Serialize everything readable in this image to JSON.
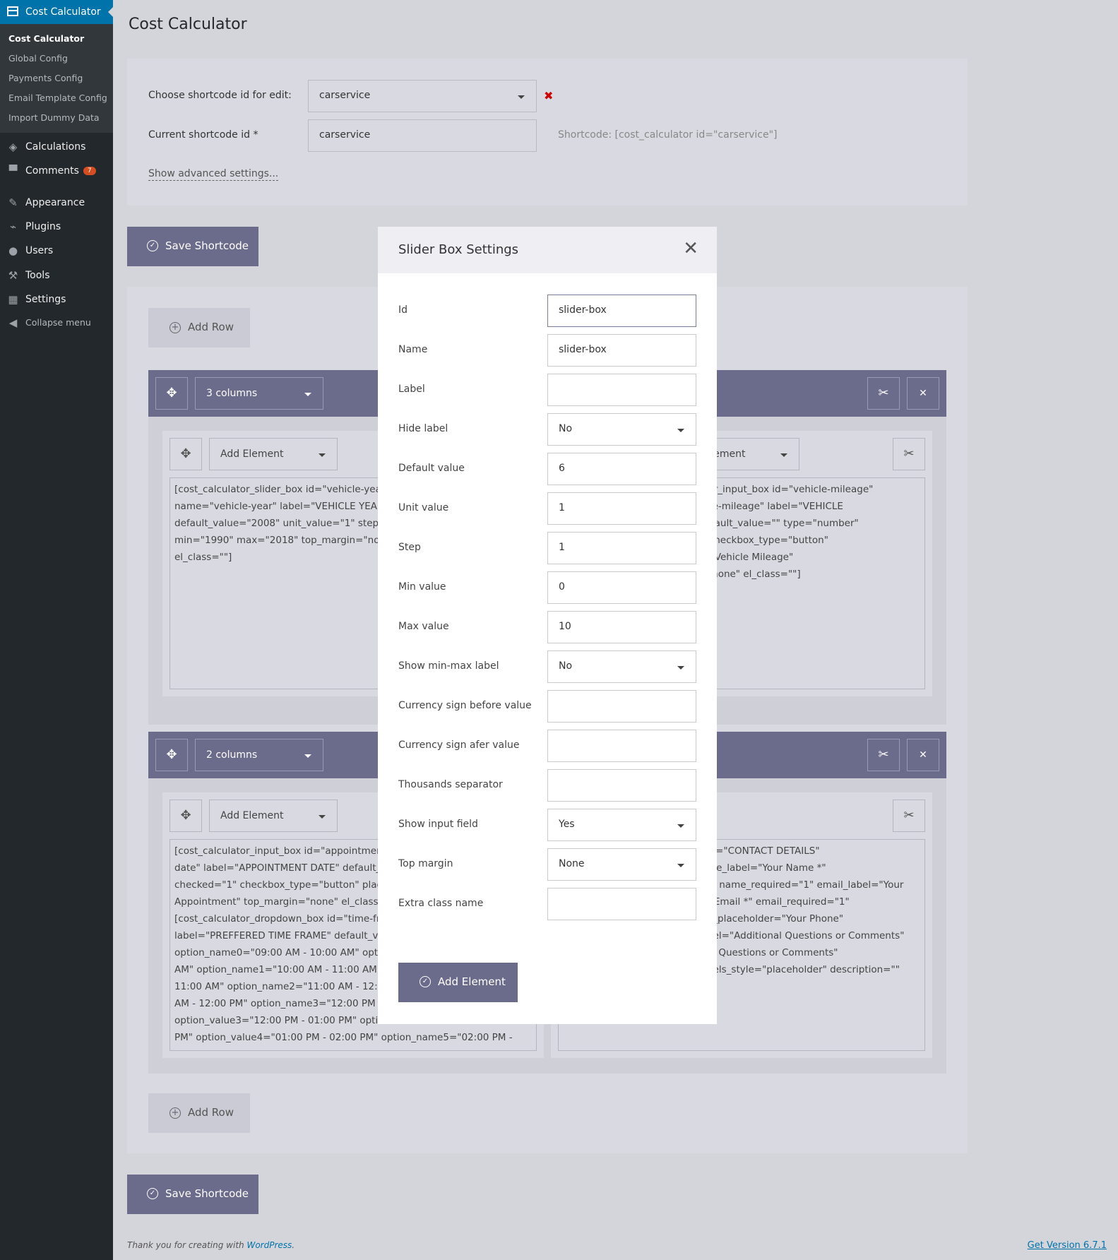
{
  "sidebar": {
    "top_label": "Cost Calculator",
    "sub_items": [
      {
        "label": "Cost Calculator"
      },
      {
        "label": "Global Config"
      },
      {
        "label": "Payments Config"
      },
      {
        "label": "Email Template Config"
      },
      {
        "label": "Import Dummy Data"
      }
    ],
    "menu": [
      {
        "label": "Calculations",
        "icon": "tag-icon"
      },
      {
        "label": "Comments",
        "icon": "comment-icon",
        "badge": "7"
      },
      {
        "label": "Appearance",
        "icon": "brush-icon"
      },
      {
        "label": "Plugins",
        "icon": "plugin-icon"
      },
      {
        "label": "Users",
        "icon": "user-icon"
      },
      {
        "label": "Tools",
        "icon": "wrench-icon"
      },
      {
        "label": "Settings",
        "icon": "settings-icon"
      },
      {
        "label": "Collapse menu",
        "icon": "collapse-icon"
      }
    ]
  },
  "page": {
    "title": "Cost Calculator",
    "choose_label": "Choose shortcode id for edit:",
    "choose_value": "carservice",
    "current_label": "Current shortcode id *",
    "current_value": "carservice",
    "shortcode_hint": "Shortcode: [cost_calculator id=\"carservice\"]",
    "advanced_link": "Show advanced settings...",
    "save_label": "Save Shortcode",
    "add_row_label": "Add Row",
    "row1_columns": "3 columns",
    "row2_columns": "2 columns",
    "add_element": "Add Element",
    "row1_col1_text": "[cost_calculator_slider_box id=\"vehicle-year\"\nname=\"vehicle-year\" label=\"VEHICLE YEAR\"\ndefault_value=\"2008\" unit_value=\"1\" step=\"1\nmin=\"1990\" max=\"2018\" top_margin=\"none\"\nel_class=\"\"]",
    "row1_col3_text": "_calculator_input_box id=\"vehicle-mileage\"\ne=\"vehicle-mileage\" label=\"VEHICLE\nEAGE\" default_value=\"\" type=\"number\"\nked=\"1\" checkbox_type=\"button\"\neholder=\"Vehicle Mileage\"\nmargin=\"none\" el_class=\"\"]",
    "row2_col1_text": "[cost_calculator_input_box id=\"appointment-\ndate\" label=\"APPOINTMENT DATE\" default_v\nchecked=\"1\" checkbox_type=\"button\" placeh\nAppointment\" top_margin=\"none\" el_class=\"\n[cost_calculator_dropdown_box id=\"time-fra\nlabel=\"PREFFERED TIME FRAME\" default_valu\noption_name0=\"09:00 AM - 10:00 AM\" option\nAM\" option_name1=\"10:00 AM - 11:00 AM\" o\n11:00 AM\" option_name2=\"11:00 AM - 12:00\nAM - 12:00 PM\" option_name3=\"12:00 PM - 0\noption_value3=\"12:00 PM - 01:00 PM\" option\nPM\" option_value4=\"01:00 PM - 02:00 PM\" option_name5=\"02:00 PM -",
    "row2_col2_text": "el=\"CONTACT DETAILS\"\nme_label=\"Your Name *\"\n*\" name_required=\"1\" email_label=\"Your\nr Email *\" email_required=\"1\"\ne_placeholder=\"Your Phone\"\nbel=\"Additional Questions or Comments\"\nal Questions or Comments\"\nbels_style=\"placeholder\" description=\"\"",
    "footer_text": "Thank you for creating with",
    "footer_link": "WordPress",
    "version": "Get Version 6.7.1"
  },
  "modal": {
    "title": "Slider Box Settings",
    "fields": [
      {
        "label": "Id",
        "value": "slider-box"
      },
      {
        "label": "Name",
        "value": "slider-box"
      },
      {
        "label": "Label",
        "value": ""
      },
      {
        "label": "Hide label",
        "value": "No"
      },
      {
        "label": "Default value",
        "value": "6"
      },
      {
        "label": "Unit value",
        "value": "1"
      },
      {
        "label": "Step",
        "value": "1"
      },
      {
        "label": "Min value",
        "value": "0"
      },
      {
        "label": "Max value",
        "value": "10"
      },
      {
        "label": "Show min-max label",
        "value": "No"
      },
      {
        "label": "Currency sign before value",
        "value": ""
      },
      {
        "label": "Currency sign afer value",
        "value": ""
      },
      {
        "label": "Thousands separator",
        "value": ""
      },
      {
        "label": "Show input field",
        "value": "Yes"
      },
      {
        "label": "Top margin",
        "value": "None"
      },
      {
        "label": "Extra class name",
        "value": ""
      }
    ],
    "add_button": "Add Element"
  }
}
